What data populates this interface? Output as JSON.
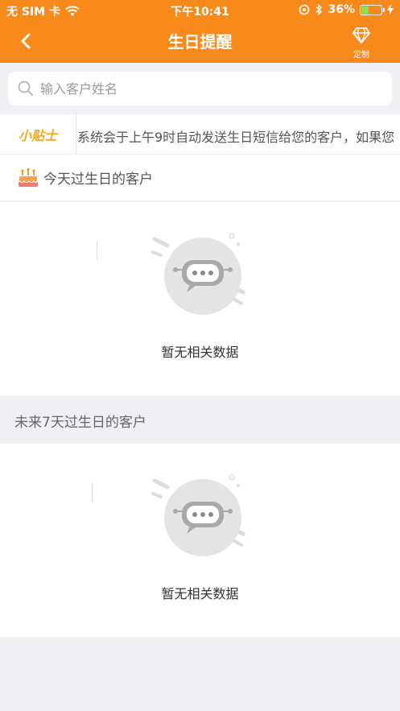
{
  "status_bar": {
    "carrier": "无 SIM 卡",
    "time": "下午10:41",
    "battery": "36%",
    "battery_level": 0.36
  },
  "navbar": {
    "title": "生日提醒",
    "custom_label": "定制",
    "back_icon": "chevron-left-icon",
    "custom_icon": "diamond-icon"
  },
  "search": {
    "placeholder": "输入客户姓名",
    "value": ""
  },
  "tips": {
    "tag": "小贴士",
    "message": "系统会于上午9时自动发送生日短信给您的客户，如果您"
  },
  "sections": {
    "today": {
      "title": "今天过生日的客户",
      "empty_text": "暂无相关数据"
    },
    "next7": {
      "title": "未来7天过生日的客户",
      "empty_text": "暂无相关数据"
    }
  },
  "colors": {
    "brand": "#f8891b",
    "tips_tag": "#f5a623",
    "background": "#efeff4"
  }
}
